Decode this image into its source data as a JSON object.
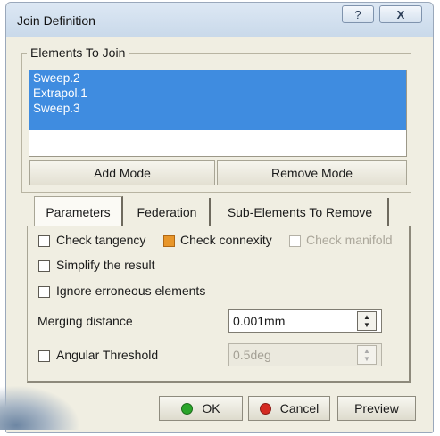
{
  "window": {
    "title": "Join Definition",
    "help_glyph": "?",
    "close_glyph": "X"
  },
  "elements_group": {
    "label": "Elements To Join",
    "items": [
      "Sweep.2",
      "Extrapol.1",
      "Sweep.3"
    ],
    "add_mode_label": "Add Mode",
    "remove_mode_label": "Remove Mode"
  },
  "tabs": [
    {
      "label": "Parameters",
      "active": true
    },
    {
      "label": "Federation",
      "active": false
    },
    {
      "label": "Sub-Elements To Remove",
      "active": false
    }
  ],
  "parameters": {
    "check_tangency": {
      "label": "Check tangency",
      "checked": false
    },
    "check_connexity": {
      "label": "Check connexity",
      "checked": true
    },
    "check_manifold": {
      "label": "Check manifold",
      "checked": false,
      "disabled": true
    },
    "simplify_result": {
      "label": "Simplify the result",
      "checked": false
    },
    "ignore_erroneous": {
      "label": "Ignore erroneous elements",
      "checked": false
    },
    "merging_distance": {
      "label": "Merging distance",
      "value": "0.001mm"
    },
    "angular_threshold": {
      "label": "Angular Threshold",
      "checked": false,
      "value": "0.5deg",
      "disabled": true
    }
  },
  "buttons": {
    "ok": "OK",
    "cancel": "Cancel",
    "preview": "Preview"
  },
  "colors": {
    "selection": "#3f8ce0",
    "dialog_bg": "#f0eee2",
    "ok_dot": "#2aa52a",
    "cancel_dot": "#d42a22",
    "checked_box": "#e8962a"
  }
}
